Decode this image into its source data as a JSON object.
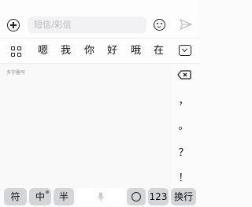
{
  "compose": {
    "input_placeholder": "短信/彩信"
  },
  "candidates": [
    "嗯",
    "我",
    "你",
    "好",
    "哦",
    "在"
  ],
  "handwriting": {
    "label": "多字叠写"
  },
  "punctuation": [
    "，",
    "。",
    "？",
    "！"
  ],
  "keys": {
    "symbols": "符",
    "chinese": "中",
    "half_width": "半",
    "numbers": "123",
    "newline": "换行"
  },
  "icons": {
    "add": "plus-circle-icon",
    "emoji": "smiley-icon",
    "send": "paper-plane-icon",
    "grid": "grid-menu-icon",
    "collapse": "keyboard-collapse-icon",
    "backspace": "backspace-icon",
    "mic": "microphone-icon"
  }
}
